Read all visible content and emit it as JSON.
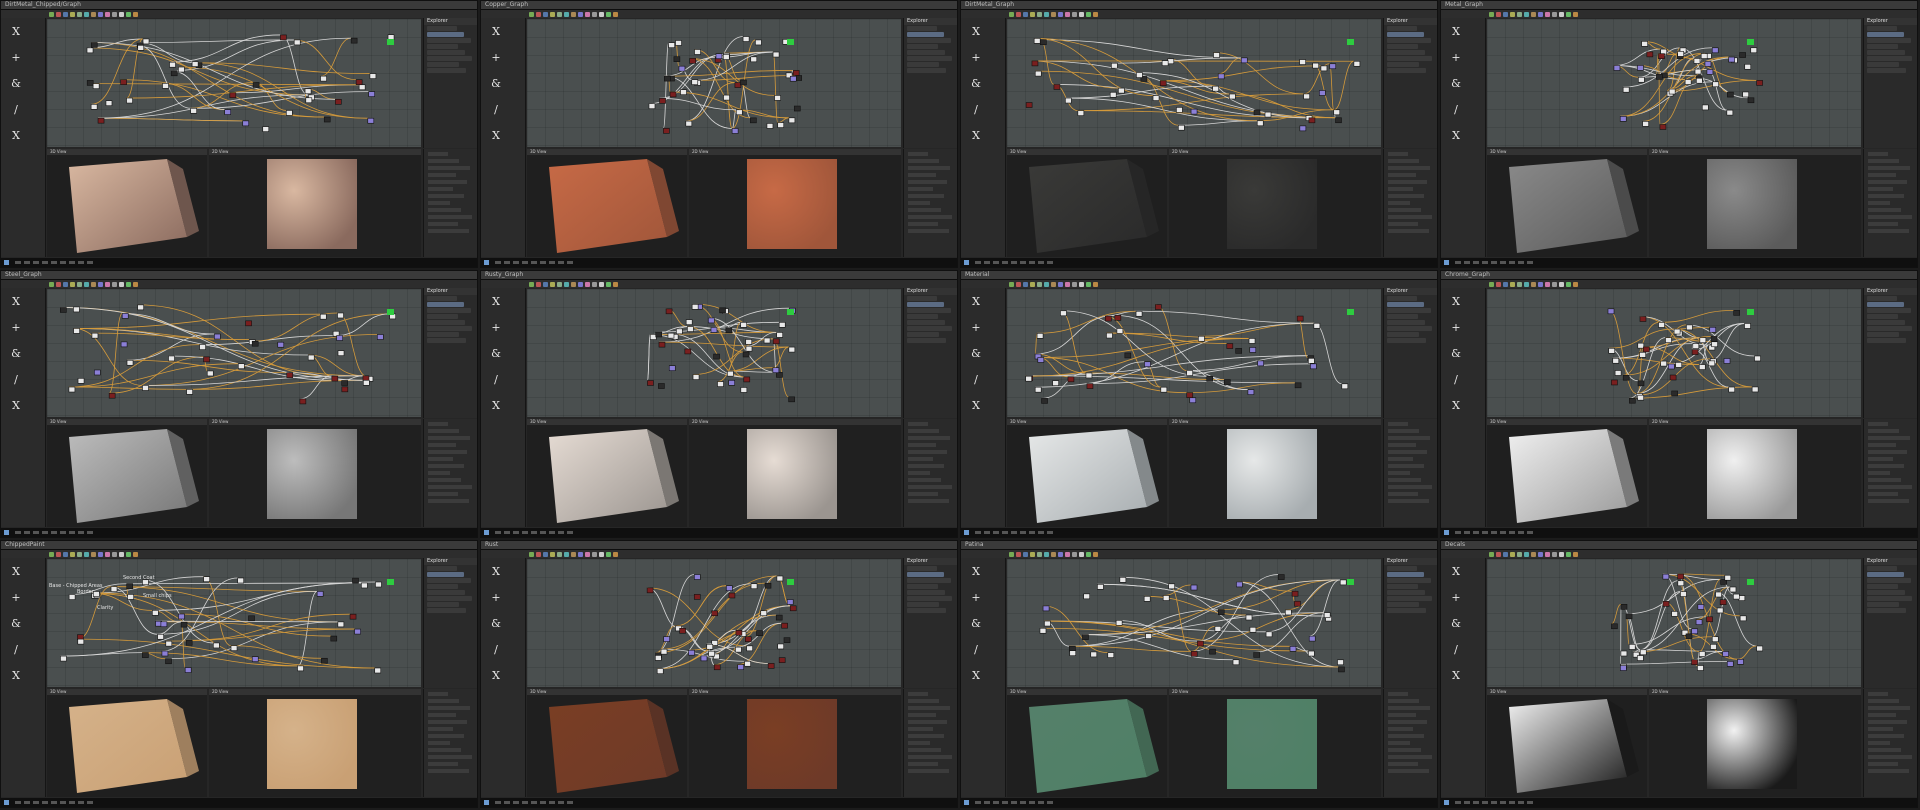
{
  "panels": [
    {
      "title": "DirtMetal_Chipped/Graph",
      "swatch": "#8a6a5e",
      "swatch2": "#d9b8a1"
    },
    {
      "title": "Copper_Graph",
      "swatch": "#a0563a",
      "swatch2": "#c76a46"
    },
    {
      "title": "DirtMetal_Graph",
      "swatch": "#2a2a2a",
      "swatch2": "#3a3a38"
    },
    {
      "title": "Metal_Graph",
      "swatch": "#5b5b5b",
      "swatch2": "#8a8a8a"
    },
    {
      "title": "Steel_Graph",
      "swatch": "#777777",
      "swatch2": "#bdbdbd"
    },
    {
      "title": "Rusty_Graph",
      "swatch": "#9b9590",
      "swatch2": "#e6dcd4"
    },
    {
      "title": "Material",
      "swatch": "#a7adb0",
      "swatch2": "#e6e8e8"
    },
    {
      "title": "Chrome_Graph",
      "swatch": "#9a9a9a",
      "swatch2": "#f0f0f0"
    },
    {
      "title": "ChippedPaint",
      "swatch": "#c9a074",
      "swatch2": "#d5b28a"
    },
    {
      "title": "Rust",
      "swatch": "#6e3a28",
      "swatch2": "#7a3e24"
    },
    {
      "title": "Patina",
      "swatch": "#4f8066",
      "swatch2": "#55806a"
    },
    {
      "title": "Decals",
      "swatch": "#1a1a1a",
      "swatch2": "#f2f2f2"
    }
  ],
  "labels": {
    "view3d": "3D View",
    "view2d": "2D View",
    "explorer": "Explorer",
    "icons": [
      "X",
      "+",
      "&",
      "/",
      "X"
    ]
  },
  "graph_notes": [
    "Base - Chipped Areas",
    "Border",
    "Clarity",
    "Second Coat",
    "Small chips"
  ],
  "colors": {
    "node_white": "#e8e8e8",
    "node_purple": "#8b7fd6",
    "node_green": "#2ecc40",
    "node_red": "#7a1f1f",
    "wire_orange": "#d49a3b",
    "wire_white": "#d6d6d6"
  }
}
